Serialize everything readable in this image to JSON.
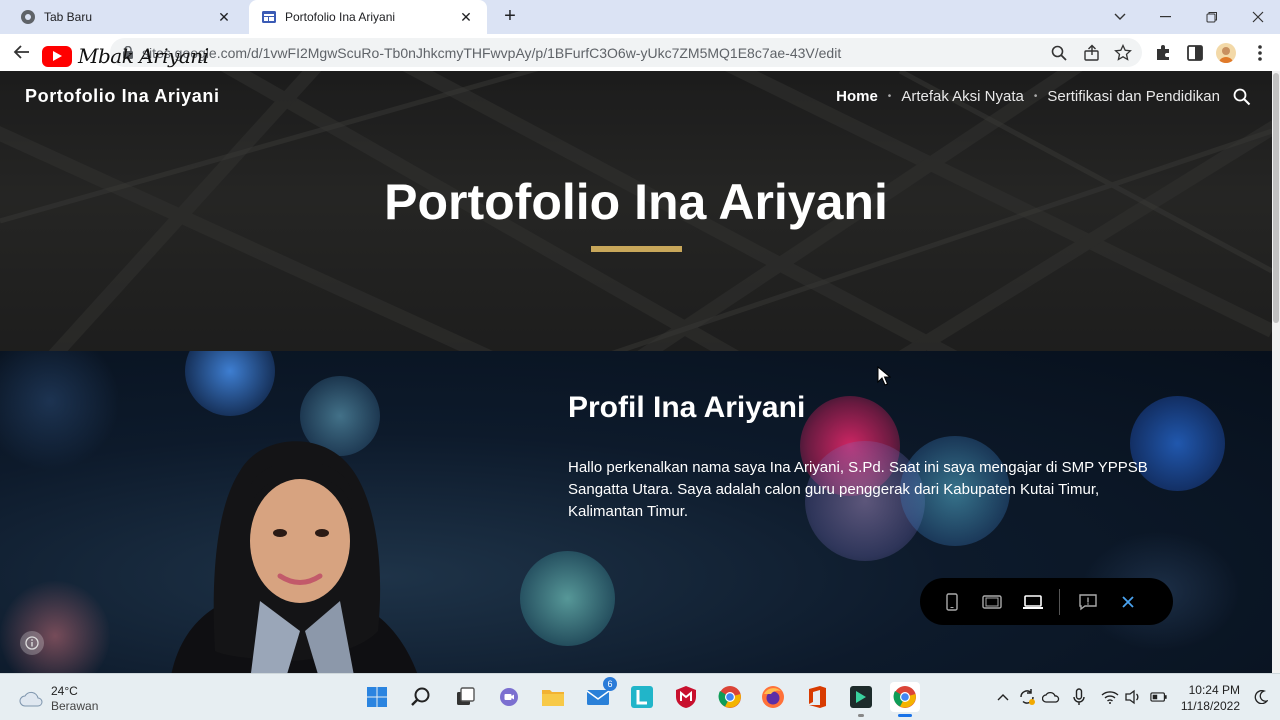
{
  "browser": {
    "tabs": [
      {
        "title": "Tab Baru",
        "active": false
      },
      {
        "title": "Portofolio Ina Ariyani",
        "active": true
      }
    ],
    "url": "sites.google.com/d/1vwFI2MgwScuRo-Tb0nJhkcmyTHFwvpAy/p/1BFurfC3O6w-yUkc7ZM5MQ1E8c7ae-43V/edit",
    "overlay_channel": "Mbak Ariyani"
  },
  "site": {
    "title": "Portofolio Ina Ariyani",
    "nav": [
      "Home",
      "Artefak Aksi Nyata",
      "Sertifikasi dan Pendidikan"
    ],
    "hero_title": "Portofolio Ina Ariyani",
    "accent_color": "#c8a75a"
  },
  "profile": {
    "heading": "Profil Ina Ariyani",
    "text": "Hallo perkenalkan nama saya Ina Ariyani, S.Pd. Saat ini saya mengajar di SMP YPPSB Sangatta Utara. Saya adalah calon guru penggerak dari Kabupaten Kutai Timur, Kalimantan Timur."
  },
  "preview_bar": {
    "buttons": [
      "phone-icon",
      "tablet-icon",
      "laptop-icon",
      "feedback-icon",
      "close-icon"
    ]
  },
  "taskbar": {
    "weather_temp": "24°C",
    "weather_cond": "Berawan",
    "mail_badge": "6",
    "time": "10:24 PM",
    "date": "11/18/2022"
  }
}
